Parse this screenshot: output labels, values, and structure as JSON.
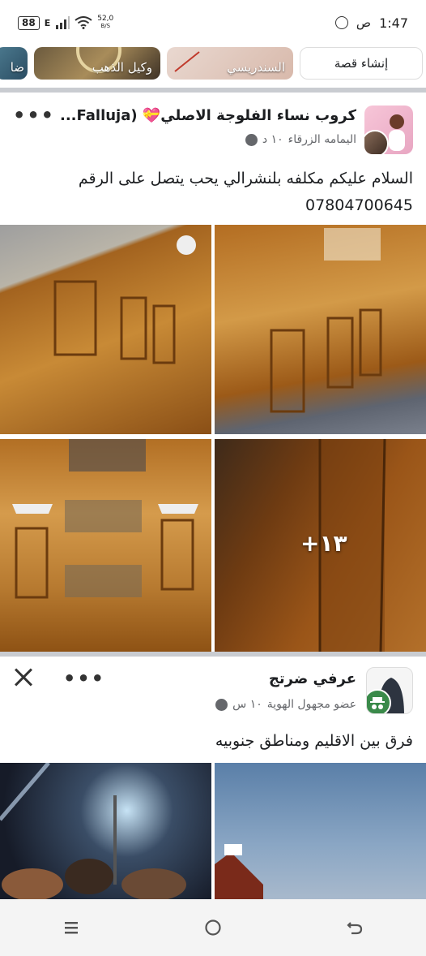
{
  "status_bar": {
    "battery": "88",
    "network_type": "E",
    "net_speed_value": "52,0",
    "net_speed_unit": "B/S",
    "time": "1:47",
    "ampm": "ص"
  },
  "stories": {
    "create_label": "إنشاء قصة",
    "items": [
      {
        "label": "السندريسي"
      },
      {
        "label": "وكيل الذهب"
      },
      {
        "label": "ضا"
      }
    ]
  },
  "post1": {
    "group_name": "كروب نساء الفلوجة الاصلي💝 (Falluja...",
    "author": "اليمامه الزرقاء",
    "time": "١٠ د",
    "text_line1": "السلام عليكم مكلفه بلنشرالي يحب يتصل على الرقم",
    "text_line2": "07804700645",
    "more_photos": "+١٣",
    "more_icon": "•••"
  },
  "post2": {
    "name": "عرفي ضرتج",
    "meta": "عضو مجهول الهوية",
    "time": "١٠ س",
    "text": "فرق بين الاقليم ومناطق جنوبيه",
    "more_icon": "•••"
  },
  "colors": {
    "wood_dark": "#7a4410",
    "wood_light": "#c58a3a",
    "sky": "#5a7fa8"
  }
}
